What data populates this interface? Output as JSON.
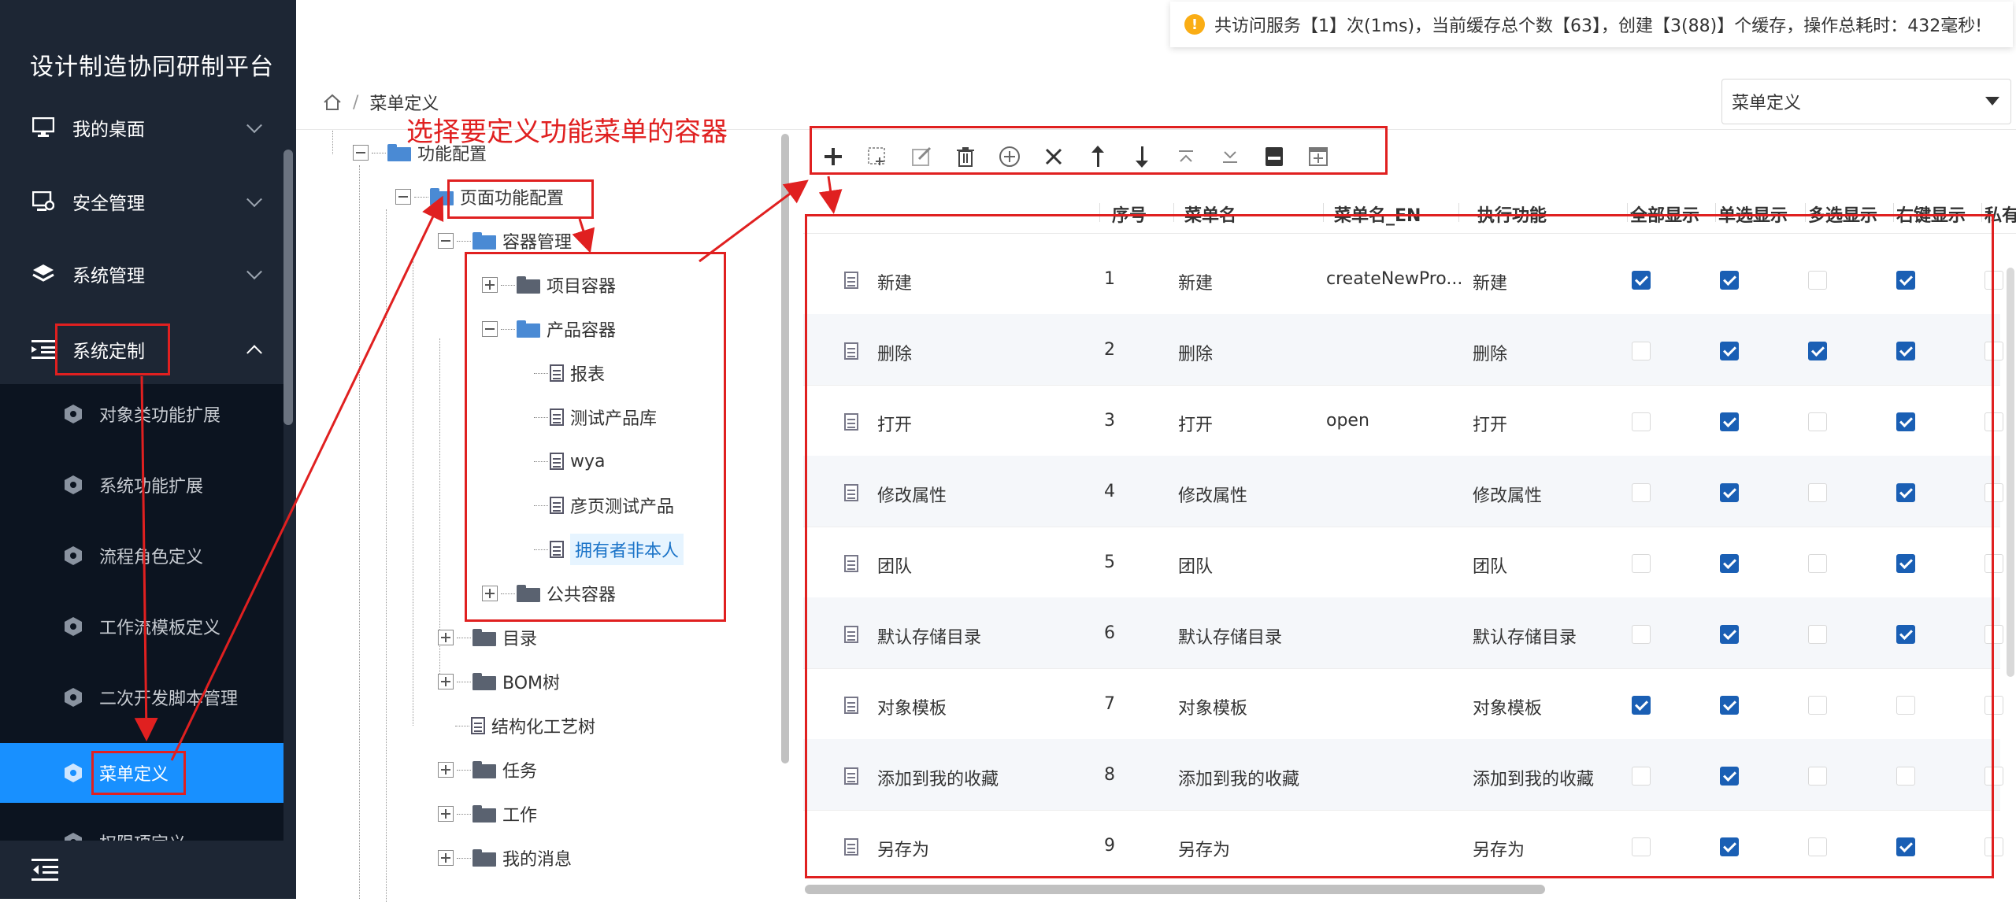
{
  "app": {
    "title": "设计制造协同研制平台"
  },
  "sidebar": {
    "items": [
      {
        "label": "我的桌面",
        "icon": "monitor-icon"
      },
      {
        "label": "安全管理",
        "icon": "monitor-gear-icon"
      },
      {
        "label": "系统管理",
        "icon": "layers-icon"
      },
      {
        "label": "系统定制",
        "icon": "list-indent-icon"
      }
    ],
    "subitems": [
      {
        "label": "对象类功能扩展"
      },
      {
        "label": "系统功能扩展"
      },
      {
        "label": "流程角色定义"
      },
      {
        "label": "工作流模板定义"
      },
      {
        "label": "二次开发脚本管理"
      },
      {
        "label": "菜单定义"
      },
      {
        "label": "权限项定义"
      }
    ]
  },
  "notice": {
    "text": "共访问服务【1】次(1ms)，当前缓存总个数【63】，创建【3(88)】个缓存，操作总耗时：432毫秒!"
  },
  "breadcrumb": {
    "current": "菜单定义"
  },
  "top_select": {
    "value": "菜单定义"
  },
  "annotation": {
    "text": "选择要定义功能菜单的容器"
  },
  "tree": {
    "root": "功能配置",
    "page_config": "页面功能配置",
    "container_mgmt": "容器管理",
    "project_container": "项目容器",
    "product_container": "产品容器",
    "children": [
      "报表",
      "测试产品库",
      "wya",
      "彦页测试产品",
      "拥有者非本人"
    ],
    "public_container": "公共容器",
    "others": [
      "目录",
      "BOM树",
      "结构化工艺树",
      "任务",
      "工作",
      "我的消息"
    ]
  },
  "table": {
    "columns": [
      "序号",
      "菜单名",
      "菜单名_EN",
      "执行功能",
      "全部显示",
      "单选显示",
      "多选显示",
      "右键显示",
      "私有"
    ],
    "rows": [
      {
        "name": "新建",
        "no": "1",
        "menu": "新建",
        "en": "createNewPro...",
        "func": "新建",
        "checks": [
          true,
          true,
          false,
          true,
          false
        ]
      },
      {
        "name": "删除",
        "no": "2",
        "menu": "删除",
        "en": "",
        "func": "删除",
        "checks": [
          false,
          true,
          true,
          true,
          false
        ]
      },
      {
        "name": "打开",
        "no": "3",
        "menu": "打开",
        "en": "open",
        "func": "打开",
        "checks": [
          false,
          true,
          false,
          true,
          false
        ]
      },
      {
        "name": "修改属性",
        "no": "4",
        "menu": "修改属性",
        "en": "",
        "func": "修改属性",
        "checks": [
          false,
          true,
          false,
          true,
          false
        ]
      },
      {
        "name": "团队",
        "no": "5",
        "menu": "团队",
        "en": "",
        "func": "团队",
        "checks": [
          false,
          true,
          false,
          true,
          false
        ]
      },
      {
        "name": "默认存储目录",
        "no": "6",
        "menu": "默认存储目录",
        "en": "",
        "func": "默认存储目录",
        "checks": [
          false,
          true,
          false,
          true,
          false
        ]
      },
      {
        "name": "对象模板",
        "no": "7",
        "menu": "对象模板",
        "en": "",
        "func": "对象模板",
        "checks": [
          true,
          true,
          false,
          false,
          false
        ]
      },
      {
        "name": "添加到我的收藏",
        "no": "8",
        "menu": "添加到我的收藏",
        "en": "",
        "func": "添加到我的收藏",
        "checks": [
          false,
          true,
          false,
          false,
          false
        ]
      },
      {
        "name": "另存为",
        "no": "9",
        "menu": "另存为",
        "en": "",
        "func": "另存为",
        "checks": [
          false,
          true,
          false,
          true,
          false
        ]
      }
    ]
  },
  "colors": {
    "sidebar": "#1d2634",
    "submenu": "#0c1420",
    "active": "#1890ff",
    "annotation": "#e02020",
    "checkbox": "#1a5fb4"
  }
}
